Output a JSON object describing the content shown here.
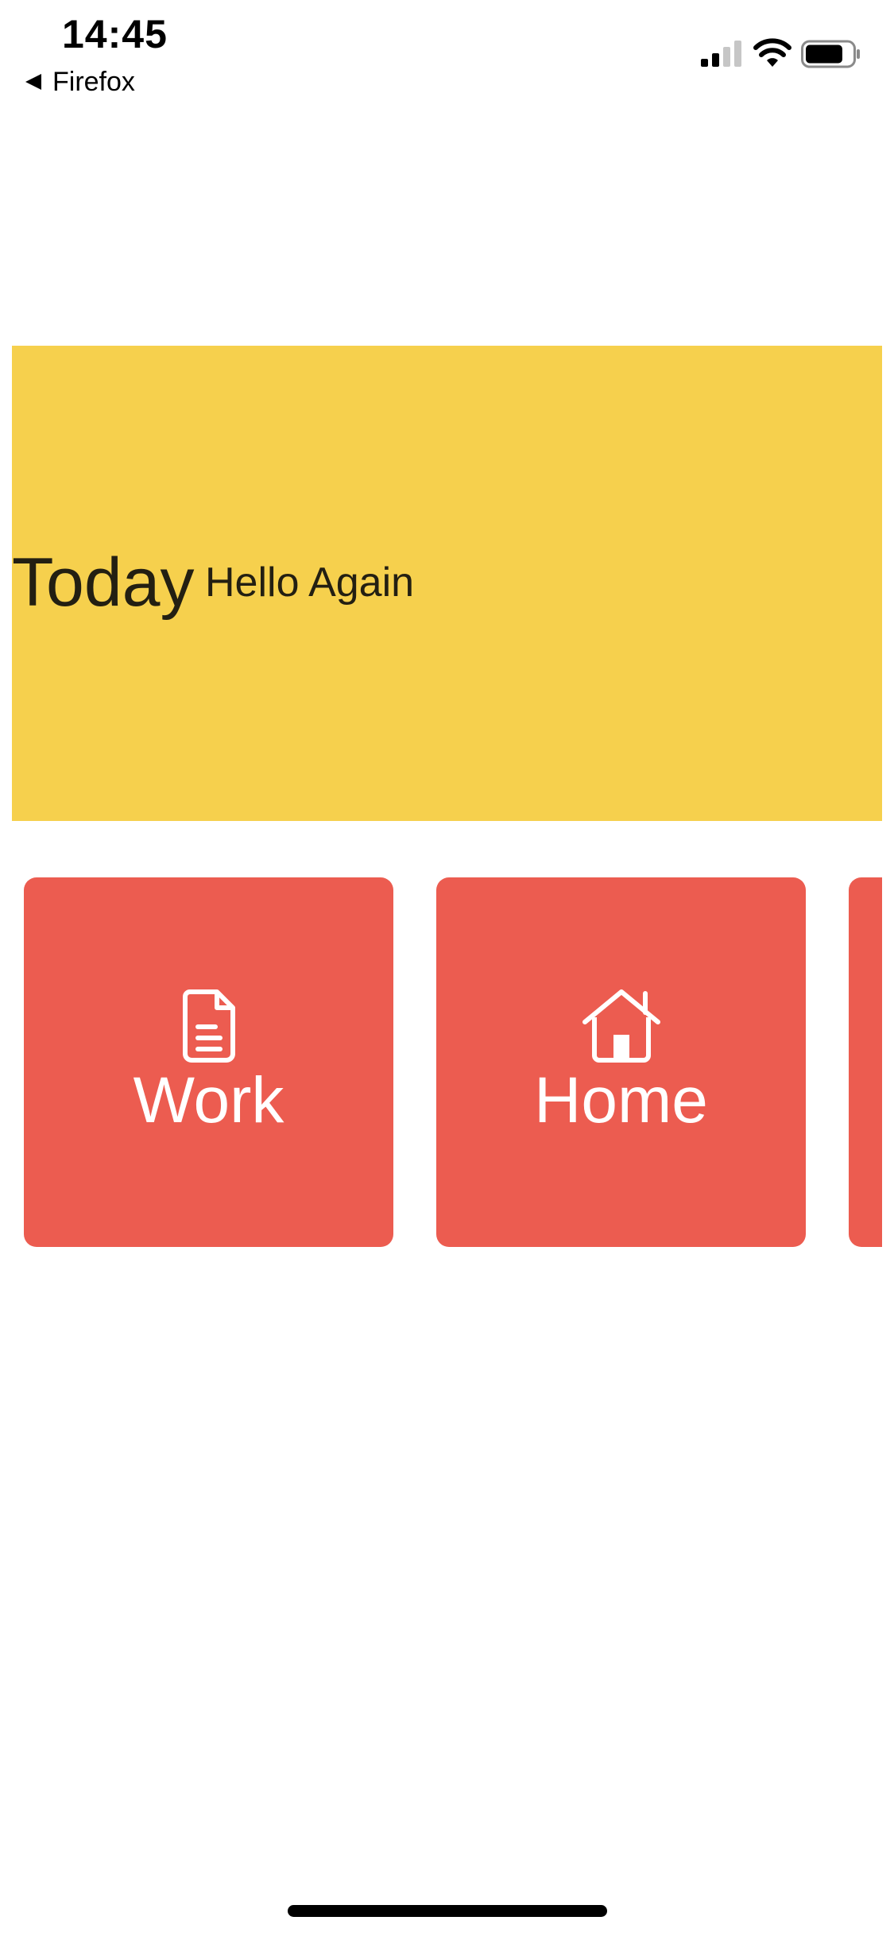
{
  "status_bar": {
    "time": "14:45",
    "back_label": "Firefox"
  },
  "hero": {
    "title": "Today",
    "subtitle": "Hello Again",
    "background_color": "#F6D04D"
  },
  "categories": [
    {
      "label": "Work",
      "icon": "document-icon"
    },
    {
      "label": "Home",
      "icon": "house-icon"
    }
  ],
  "colors": {
    "card": "#EC5C50",
    "banner": "#F6D04D"
  }
}
